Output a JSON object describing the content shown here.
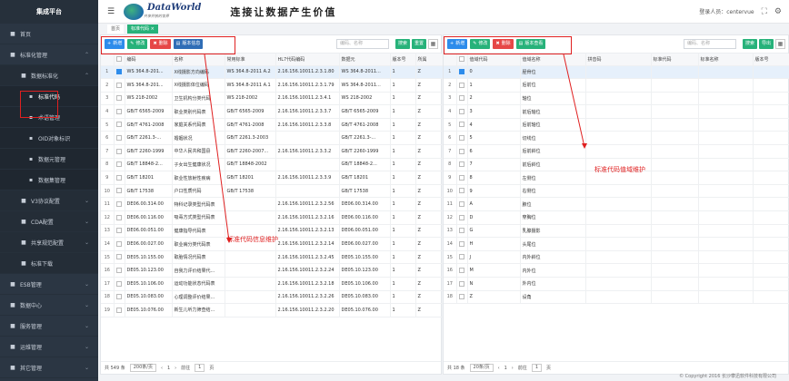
{
  "app": {
    "title": "集成平台",
    "slogan": "连接让数据产生价值",
    "logo_text": "DataWorld",
    "logo_sub": "共享开放的世界"
  },
  "header": {
    "user_label": "登录人员：centervue"
  },
  "sidebar": {
    "items": [
      {
        "label": "首页",
        "icon": "home-icon",
        "level": 0
      },
      {
        "label": "标准化管理",
        "icon": "grid-icon",
        "level": 0,
        "chev": "⌃"
      },
      {
        "label": "数据标准化",
        "icon": "gear-icon",
        "level": 1,
        "chev": "⌃"
      },
      {
        "label": "标准代码",
        "icon": "list-icon",
        "level": 2,
        "active": true
      },
      {
        "label": "术语管理",
        "icon": "list-icon",
        "level": 2
      },
      {
        "label": "OID对象标识",
        "icon": "list-icon",
        "level": 2
      },
      {
        "label": "数据元管理",
        "icon": "list-icon",
        "level": 2
      },
      {
        "label": "数据集管理",
        "icon": "list-icon",
        "level": 2
      },
      {
        "label": "V3协议配置",
        "icon": "gear-icon",
        "level": 1,
        "chev": "⌄"
      },
      {
        "label": "CDA配置",
        "icon": "gear-icon",
        "level": 1,
        "chev": "⌄"
      },
      {
        "label": "共享规范配置",
        "icon": "gear-icon",
        "level": 1,
        "chev": "⌄"
      },
      {
        "label": "标准下载",
        "icon": "download-icon",
        "level": 1
      },
      {
        "label": "ESB管理",
        "icon": "grid-icon",
        "level": 0,
        "chev": "⌄"
      },
      {
        "label": "数据中心",
        "icon": "grid-icon",
        "level": 0,
        "chev": "⌄"
      },
      {
        "label": "服务管理",
        "icon": "grid-icon",
        "level": 0,
        "chev": "⌄"
      },
      {
        "label": "运维管理",
        "icon": "grid-icon",
        "level": 0,
        "chev": "⌄"
      },
      {
        "label": "其它管理",
        "icon": "grid-icon",
        "level": 0,
        "chev": "⌄"
      }
    ]
  },
  "tabs": [
    {
      "label": "首页"
    },
    {
      "label": "标准代码 ×",
      "active": true
    }
  ],
  "left": {
    "buttons": [
      "新增",
      "修改",
      "删除",
      "版本信息"
    ],
    "search_placeholder": "编码、名称",
    "search_btn": "搜索",
    "reset_btn": "重置",
    "columns": [
      "",
      "",
      "编码",
      "名称",
      "常用标准",
      "HL7代码编码",
      "数据元",
      "版本号",
      "所属"
    ],
    "rows": [
      [
        "1",
        "WS 364.8-201...",
        "X线摄影方向编码",
        "WS 364.8-2011 A.2",
        "2.16.156.10011.2.3.1.80",
        "WS 364.8-2011...",
        "1",
        "Z"
      ],
      [
        "2",
        "WS 364.8-201...",
        "X线摄影体位编码",
        "WS 364.8-2011 A.1",
        "2.16.156.10011.2.3.1.79",
        "WS 364.8-2011...",
        "1",
        "Z"
      ],
      [
        "3",
        "WS 218-2002",
        "卫生机构分类代码",
        "WS 218-2002",
        "2.16.156.10011.2.3.4.1",
        "WS 218-2002",
        "1",
        "Z"
      ],
      [
        "4",
        "GB/T 6565-2009",
        "职业类别代码表",
        "GB/T 6565-2009",
        "2.16.156.10011.2.3.3.7",
        "GB/T 6565-2009",
        "1",
        "Z"
      ],
      [
        "5",
        "GB/T 4761-2008",
        "家庭关系代码表",
        "GB/T 4761-2008",
        "2.16.156.10011.2.3.3.8",
        "GB/T 4761-2008",
        "1",
        "Z"
      ],
      [
        "6",
        "GB/T 2261.3-...",
        "婚姻状况",
        "GB/T 2261.3-2003",
        "",
        "GB/T 2261.3-...",
        "1",
        "Z"
      ],
      [
        "7",
        "GB/T 2260-1999",
        "中华人民共和国县",
        "GB/T 2260-2007...",
        "2.16.156.10011.2.3.3.2",
        "GB/T 2260-1999",
        "1",
        "Z"
      ],
      [
        "8",
        "GB/T 18848-2...",
        "子女出生健康状况",
        "GB/T 18848-2002",
        "",
        "GB/T 18848-2...",
        "1",
        "Z"
      ],
      [
        "9",
        "GB/T 18201",
        "职业性放射性疾病",
        "GB/T 18201",
        "2.16.156.10011.2.3.3.9",
        "GB/T 18201",
        "1",
        "Z"
      ],
      [
        "10",
        "GB/T 17538",
        "户口性质代码",
        "GB/T 17538",
        "",
        "GB/T 17538",
        "1",
        "Z"
      ],
      [
        "11",
        "DE06.00.314.00",
        "特科记录类型代码表",
        "",
        "2.16.156.10011.2.3.2.56",
        "DE06.00.314.00",
        "1",
        "Z"
      ],
      [
        "12",
        "DE06.00.116.00",
        "吸毒方式类型代码表",
        "",
        "2.16.156.10011.2.3.2.16",
        "DE06.00.116.00",
        "1",
        "Z"
      ],
      [
        "13",
        "DE06.00.051.00",
        "健康指导代码表",
        "",
        "2.16.156.10011.2.3.2.13",
        "DE06.00.051.00",
        "1",
        "Z"
      ],
      [
        "14",
        "DE06.00.027.00",
        "职业病分类代码表",
        "",
        "2.16.156.10011.2.3.2.14",
        "DE06.00.027.00",
        "1",
        "Z"
      ],
      [
        "15",
        "DE05.10.155.00",
        "取胎情况代码表",
        "",
        "2.16.156.10011.2.3.2.45",
        "DE05.10.155.00",
        "1",
        "Z"
      ],
      [
        "16",
        "DE05.10.123.00",
        "自我力评价结果代...",
        "",
        "2.16.156.10011.2.3.2.24",
        "DE05.10.123.00",
        "1",
        "Z"
      ],
      [
        "17",
        "DE05.10.106.00",
        "运动功能状态代码表",
        "",
        "2.16.156.10011.2.3.2.18",
        "DE05.10.106.00",
        "1",
        "Z"
      ],
      [
        "18",
        "DE05.10.083.00",
        "心理调整评价结果...",
        "",
        "2.16.156.10011.2.3.2.26",
        "DE05.10.083.00",
        "1",
        "Z"
      ],
      [
        "19",
        "DE05.10.076.00",
        "新生儿听力筛查结...",
        "",
        "2.16.156.10011.2.3.2.20",
        "DE05.10.076.00",
        "1",
        "Z"
      ]
    ],
    "footer": {
      "total": "共 549 条",
      "per_page": "200条/页",
      "goto": "前往",
      "page": "1",
      "page_unit": "页"
    }
  },
  "right": {
    "buttons": [
      "新增",
      "修改",
      "删除",
      "版本查看"
    ],
    "search_placeholder": "编码、名称",
    "search_btn": "搜索",
    "reset_btn": "导出",
    "columns": [
      "",
      "",
      "值域代码",
      "值域名称",
      "拼音码",
      "标准代码",
      "标准名称",
      "版本号"
    ],
    "rows": [
      [
        "1",
        "0",
        "胫骨位"
      ],
      [
        "2",
        "1",
        "后前位"
      ],
      [
        "3",
        "2",
        "轴位"
      ],
      [
        "4",
        "3",
        "前后轴位"
      ],
      [
        "5",
        "4",
        "后前轴位"
      ],
      [
        "6",
        "5",
        "切线位"
      ],
      [
        "7",
        "6",
        "后前斜位"
      ],
      [
        "8",
        "7",
        "前后斜位"
      ],
      [
        "9",
        "8",
        "左侧位"
      ],
      [
        "10",
        "9",
        "右侧位"
      ],
      [
        "11",
        "A",
        "腋位"
      ],
      [
        "12",
        "D",
        "穿胸位"
      ],
      [
        "13",
        "G",
        "乳腺摄影"
      ],
      [
        "14",
        "H",
        "头尾位"
      ],
      [
        "15",
        "J",
        "内外斜位"
      ],
      [
        "16",
        "M",
        "内外位"
      ],
      [
        "17",
        "N",
        "外内位"
      ],
      [
        "18",
        "Z",
        "设角"
      ]
    ],
    "footer": {
      "total": "共 18 条",
      "per_page": "20条/页",
      "goto": "前往",
      "page": "1",
      "page_unit": "页"
    }
  },
  "annotations": {
    "left": "标准代码信息维护",
    "right": "标准代码值域维护"
  },
  "copyright": "© Copyright 2016 长沙攀迅软件科技有限公司",
  "colors": {
    "sidebar": "#2b3643",
    "accent_green": "#27b27a",
    "accent_blue": "#2d8ceb",
    "accent_red": "#e64747",
    "annotation": "#e02020"
  }
}
